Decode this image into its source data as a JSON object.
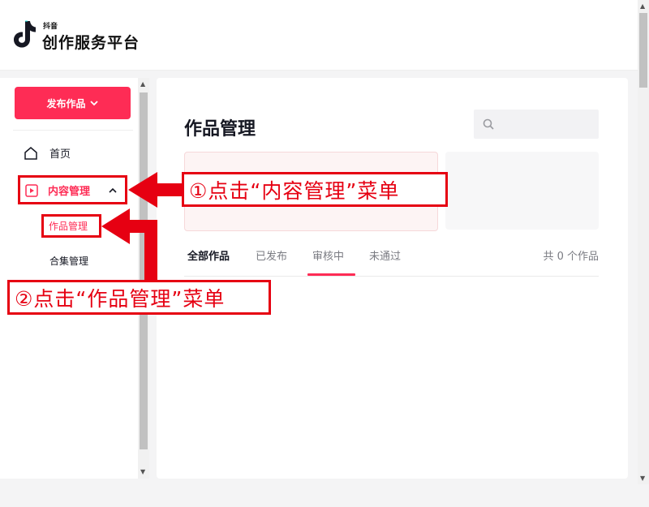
{
  "header": {
    "logo_small": "抖音",
    "logo_title": "创作服务平台"
  },
  "sidebar": {
    "publish_label": "发布作品",
    "items": [
      {
        "label": "首页"
      },
      {
        "label": "内容管理"
      },
      {
        "label": "作品管理"
      },
      {
        "label": "合集管理"
      }
    ]
  },
  "main": {
    "title": "作品管理",
    "search_placeholder": "",
    "tabs": [
      {
        "label": "全部作品"
      },
      {
        "label": "已发布"
      },
      {
        "label": "审核中"
      },
      {
        "label": "未通过"
      }
    ],
    "count_text": "共 0 个作品"
  },
  "annotations": {
    "step1": "①点击“内容管理”菜单",
    "step2": "②点击“作品管理”菜单"
  },
  "colors": {
    "accent": "#fe2c55",
    "annotation": "#e60012"
  }
}
